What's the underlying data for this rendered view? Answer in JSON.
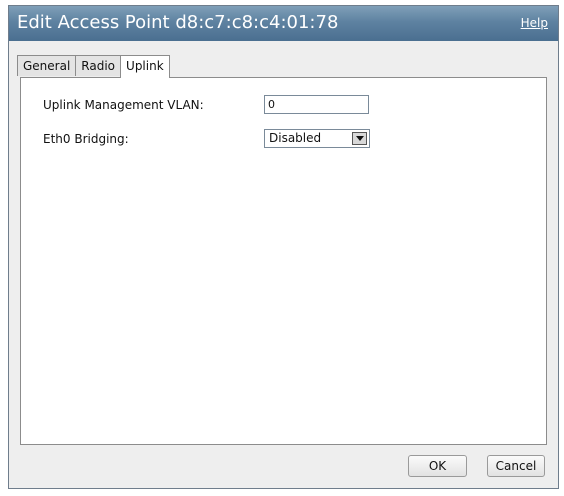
{
  "dialog": {
    "title": "Edit Access Point d8:c7:c8:c4:01:78",
    "help_label": "Help"
  },
  "tabs": [
    {
      "label": "General",
      "active": false
    },
    {
      "label": "Radio",
      "active": false
    },
    {
      "label": "Uplink",
      "active": true
    }
  ],
  "uplink": {
    "mgmt_vlan_label": "Uplink Management VLAN:",
    "mgmt_vlan_value": "0",
    "eth0_bridging_label": "Eth0 Bridging:",
    "eth0_bridging_value": "Disabled"
  },
  "buttons": {
    "ok_label": "OK",
    "cancel_label": "Cancel"
  },
  "colors": {
    "titlebar": "#5e82a1",
    "title_text": "#ffffff",
    "panel_bg": "#ffffff",
    "dialog_bg": "#eeeeee"
  },
  "icons": {
    "dropdown": "triangle-down-icon"
  }
}
